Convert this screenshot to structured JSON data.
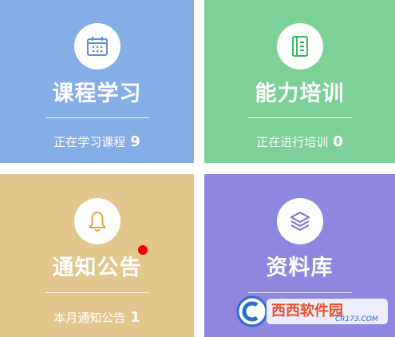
{
  "colors": {
    "course": "#85ade6",
    "ability": "#7dd096",
    "notice": "#e3c68c",
    "materials": "#8f86e0",
    "notification_dot": "#f20000"
  },
  "tiles": [
    {
      "title": "课程学习",
      "status_label": "正在学习课程",
      "count": "9",
      "icon": "calendar-icon"
    },
    {
      "title": "能力培训",
      "status_label": "正在进行培训",
      "count": "0",
      "icon": "notebook-icon"
    },
    {
      "title": "通知公告",
      "status_label": "本月通知公告",
      "count": "1",
      "icon": "bell-icon"
    },
    {
      "title": "资料库",
      "status_label": "",
      "count": "",
      "icon": "layers-icon"
    }
  ],
  "watermark": {
    "text": "西西软件园",
    "subtext": "CR173.COM"
  }
}
